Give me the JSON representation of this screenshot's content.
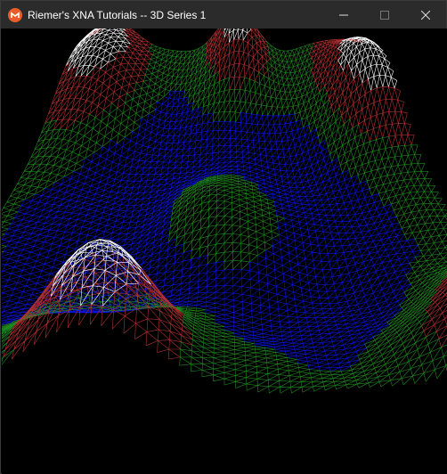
{
  "window": {
    "title": "Riemer's XNA Tutorials -- 3D Series 1",
    "app_icon": "monogame-icon",
    "controls": [
      "minimize-icon",
      "maximize-icon",
      "close-icon"
    ]
  },
  "scene": {
    "render_mode": "wireframe-terrain",
    "band_colors": {
      "peak": "#ffffff",
      "high": "#b33030",
      "mid": "#1f8a1f",
      "low": "#0a14e0"
    },
    "background": "#000000"
  }
}
